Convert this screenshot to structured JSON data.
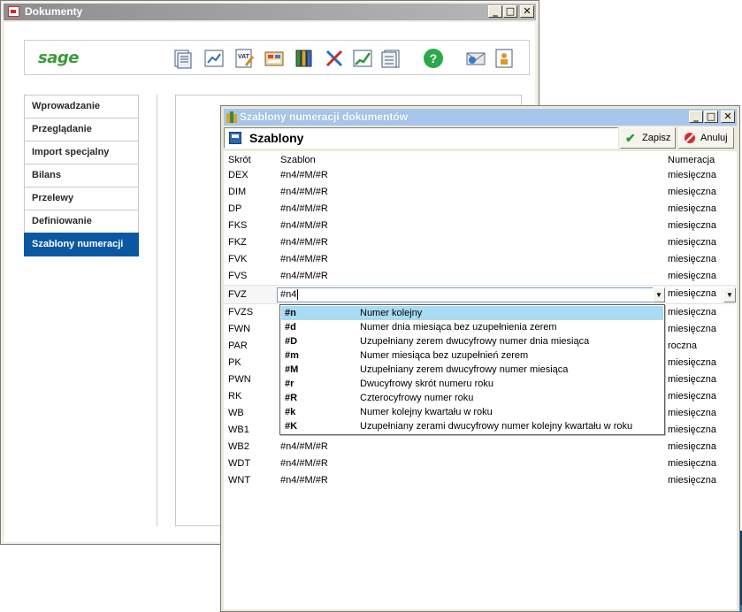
{
  "outer_window": {
    "title": "Dokumenty",
    "controls": {
      "minimize": "_",
      "maximize": "□",
      "close": "✕"
    }
  },
  "toolbar": {
    "logo": "sage",
    "icons": [
      "documents-icon",
      "chart-icon",
      "vat-icon",
      "calculator-icon",
      "binders-icon",
      "tools-icon",
      "growth-chart-icon",
      "list-icon",
      "help-icon",
      "mail-icon",
      "user-info-icon"
    ],
    "vat_text": "VAT",
    "help_text": "?"
  },
  "sidebar": {
    "items": [
      {
        "label": "Wprowadzanie",
        "active": false
      },
      {
        "label": "Przeglądanie",
        "active": false
      },
      {
        "label": "Import specjalny",
        "active": false
      },
      {
        "label": "Bilans",
        "active": false
      },
      {
        "label": "Przelewy",
        "active": false
      },
      {
        "label": "Definiowanie",
        "active": false
      },
      {
        "label": "Szablony numeracji",
        "active": true
      }
    ]
  },
  "inner_window": {
    "title": "Szablony numeracji dokumentów",
    "controls": {
      "minimize": "_",
      "maximize": "□",
      "close": "✕"
    },
    "header": "Szablony",
    "save_label": "Zapisz",
    "cancel_label": "Anuluj"
  },
  "grid": {
    "columns": [
      "Skrót",
      "Szablon",
      "Numeracja"
    ],
    "rows_above": [
      {
        "code": "DEX",
        "template": "#n4/#M/#R",
        "numbering": "miesięczna"
      },
      {
        "code": "DIM",
        "template": "#n4/#M/#R",
        "numbering": "miesięczna"
      },
      {
        "code": "DP",
        "template": "#n4/#M/#R",
        "numbering": "miesięczna"
      },
      {
        "code": "FKS",
        "template": "#n4/#M/#R",
        "numbering": "miesięczna"
      },
      {
        "code": "FKZ",
        "template": "#n4/#M/#R",
        "numbering": "miesięczna"
      },
      {
        "code": "FVK",
        "template": "#n4/#M/#R",
        "numbering": "miesięczna"
      },
      {
        "code": "FVS",
        "template": "#n4/#M/#R",
        "numbering": "miesięczna"
      }
    ],
    "editing_row": {
      "code": "FVZ",
      "template": "#n4",
      "numbering": "miesięczna"
    },
    "rows_below": [
      {
        "code": "FVZS",
        "template": "",
        "numbering": "miesięczna"
      },
      {
        "code": "FWN",
        "template": "",
        "numbering": "miesięczna"
      },
      {
        "code": "PAR",
        "template": "",
        "numbering": "roczna"
      },
      {
        "code": "PK",
        "template": "",
        "numbering": "miesięczna"
      },
      {
        "code": "PWN",
        "template": "",
        "numbering": "miesięczna"
      },
      {
        "code": "RK",
        "template": "",
        "numbering": "miesięczna"
      },
      {
        "code": "WB",
        "template": "",
        "numbering": "miesięczna"
      },
      {
        "code": "WB1",
        "template": "",
        "numbering": "miesięczna"
      },
      {
        "code": "WB2",
        "template": "#n4/#M/#R",
        "numbering": "miesięczna"
      },
      {
        "code": "WDT",
        "template": "#n4/#M/#R",
        "numbering": "miesięczna"
      },
      {
        "code": "WNT",
        "template": "#n4/#M/#R",
        "numbering": "miesięczna"
      }
    ]
  },
  "autocomplete": {
    "items": [
      {
        "code": "#n",
        "desc": "Numer kolejny",
        "selected": true
      },
      {
        "code": "#d",
        "desc": "Numer dnia miesiąca bez uzupełnienia zerem",
        "selected": false
      },
      {
        "code": "#D",
        "desc": "Uzupełniany zerem dwucyfrowy numer dnia miesiąca",
        "selected": false
      },
      {
        "code": "#m",
        "desc": "Numer miesiąca bez uzupełnień zerem",
        "selected": false
      },
      {
        "code": "#M",
        "desc": "Uzupełniany zerem dwucyfrowy numer miesiąca",
        "selected": false
      },
      {
        "code": "#r",
        "desc": "Dwucyfrowy skrót numeru roku",
        "selected": false
      },
      {
        "code": "#R",
        "desc": "Czterocyfrowy numer roku",
        "selected": false
      },
      {
        "code": "#k",
        "desc": "Numer kolejny kwartału w roku",
        "selected": false
      },
      {
        "code": "#K",
        "desc": "Uzupełniany zerami dwucyfrowy numer kolejny kwartału w roku",
        "selected": false
      }
    ]
  },
  "colors": {
    "active_nav": "#0a58a2",
    "inner_title": "#a7c6ec",
    "popup_selected": "#a8dcf3",
    "logo": "#3d9a3a"
  }
}
